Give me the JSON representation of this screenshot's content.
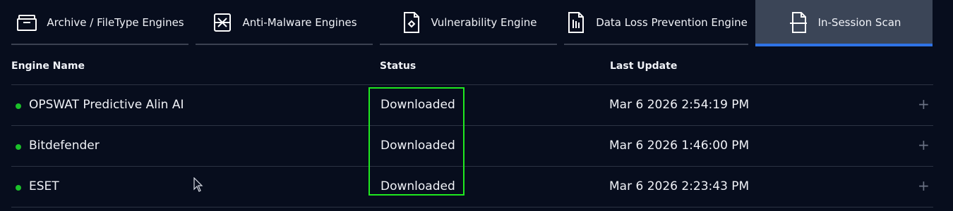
{
  "tabs": [
    {
      "label": "Archive / FileType Engines",
      "icon": "archive-icon",
      "active": false
    },
    {
      "label": "Anti-Malware Engines",
      "icon": "anti-malware-icon",
      "active": false
    },
    {
      "label": "Vulnerability Engine",
      "icon": "vulnerability-icon",
      "active": false
    },
    {
      "label": "Data Loss Prevention Engine",
      "icon": "data-loss-prevention-icon",
      "active": false
    },
    {
      "label": "In-Session Scan",
      "icon": "in-session-scan-icon",
      "active": true
    }
  ],
  "table": {
    "headers": {
      "name": "Engine Name",
      "status": "Status",
      "updated": "Last Update"
    },
    "rows": [
      {
        "name": "OPSWAT Predictive Alin AI",
        "status": "Downloaded",
        "updated": "Mar 6 2026 2:54:19 PM",
        "expand": "+"
      },
      {
        "name": "Bitdefender",
        "status": "Downloaded",
        "updated": "Mar 6 2026 1:46:00 PM",
        "expand": "+"
      },
      {
        "name": "ESET",
        "status": "Downloaded",
        "updated": "Mar 6 2026 2:23:43 PM",
        "expand": "+"
      }
    ]
  },
  "colors": {
    "background": "#070d1d",
    "active_tab": "#3b4557",
    "active_underline": "#2f73e6",
    "status_dot": "#1bc02a",
    "highlight_box": "#1fe81f"
  }
}
